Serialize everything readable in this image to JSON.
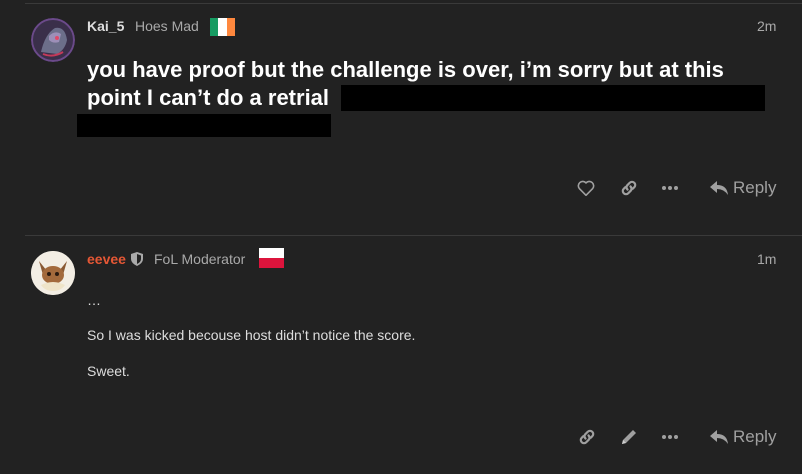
{
  "posts": [
    {
      "username": "Kai_5",
      "user_title": "Hoes Mad",
      "flag": "ireland-flag",
      "time": "2m",
      "body": "you have proof but the challenge is over, i’m sorry but at this point I can’t do a retrial",
      "actions": [
        "like-icon",
        "link-icon",
        "more-icon"
      ],
      "reply_label": "Reply"
    },
    {
      "username": "eevee",
      "user_title": "FoL Moderator",
      "flag": "poland-flag",
      "time": "1m",
      "body_lines": [
        "…",
        "So I was kicked becouse host didn’t notice the score.",
        "Sweet."
      ],
      "actions": [
        "link-icon",
        "edit-icon",
        "more-icon"
      ],
      "reply_label": "Reply"
    }
  ],
  "colors": {
    "background": "#222222",
    "moderator_name": "#e45735",
    "text_primary": "#ffffff",
    "text_muted": "#a9a9a9"
  }
}
